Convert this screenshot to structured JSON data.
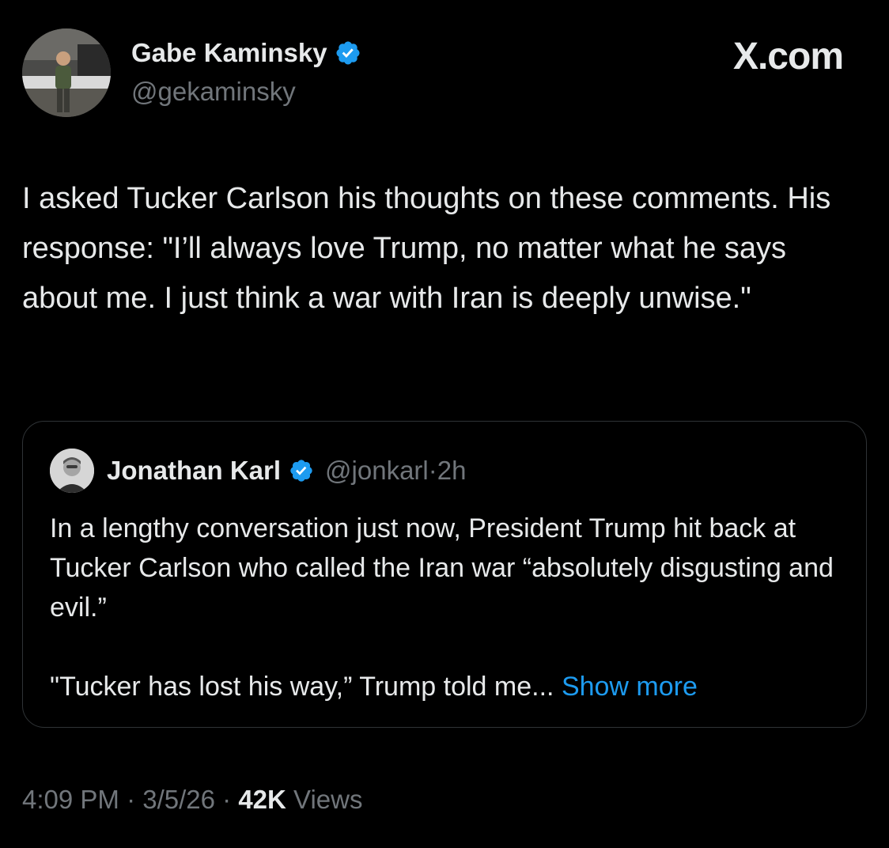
{
  "author": {
    "name": "Gabe Kaminsky",
    "handle": "@gekaminsky",
    "verified": true
  },
  "brand": "X.com",
  "tweet_text": "I asked Tucker Carlson his thoughts on these comments. His response: \"I’ll always love Trump, no matter what he says about me. I just think a war with Iran is deeply unwise.\"",
  "quoted": {
    "name": "Jonathan Karl",
    "handle": "@jonkarl",
    "separator": " · ",
    "time": "2h",
    "paragraph1": "In a lengthy conversation just now, President Trump hit back at Tucker Carlson who called the Iran war “absolutely disgusting and evil.”",
    "paragraph2": "\"Tucker has lost his way,” Trump told me...",
    "show_more": "Show more"
  },
  "meta": {
    "time": "4:09 PM",
    "sep1": " · ",
    "date": "3/5/26",
    "sep2": " · ",
    "views_count": "42K",
    "views_label": " Views"
  },
  "colors": {
    "background": "#000000",
    "text": "#e7e9ea",
    "secondary": "#71767b",
    "accent": "#1d9bf0",
    "border": "#2f3336"
  },
  "icons": [
    "avatar",
    "verified-badge-icon"
  ]
}
